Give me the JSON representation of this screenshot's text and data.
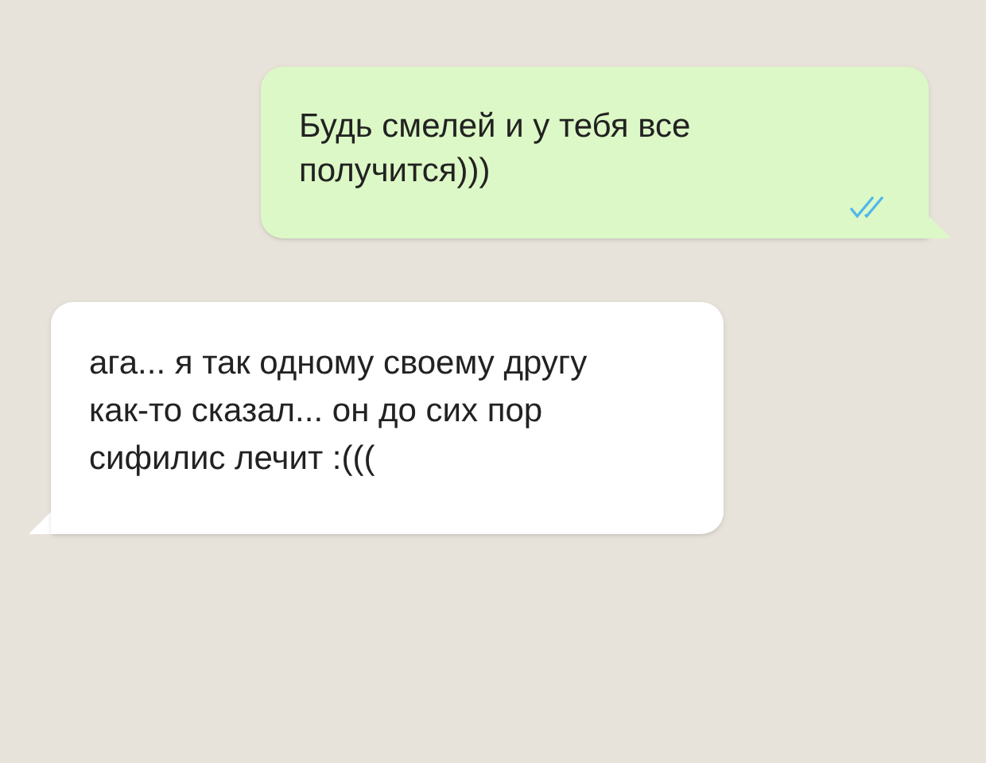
{
  "messages": [
    {
      "kind": "outgoing",
      "text": "Будь смелей и у тебя все получится)))",
      "read": true
    },
    {
      "kind": "incoming",
      "text": "ага... я так одному своему другу как-то сказал... он до сих пор сифилис лечит :((("
    }
  ]
}
